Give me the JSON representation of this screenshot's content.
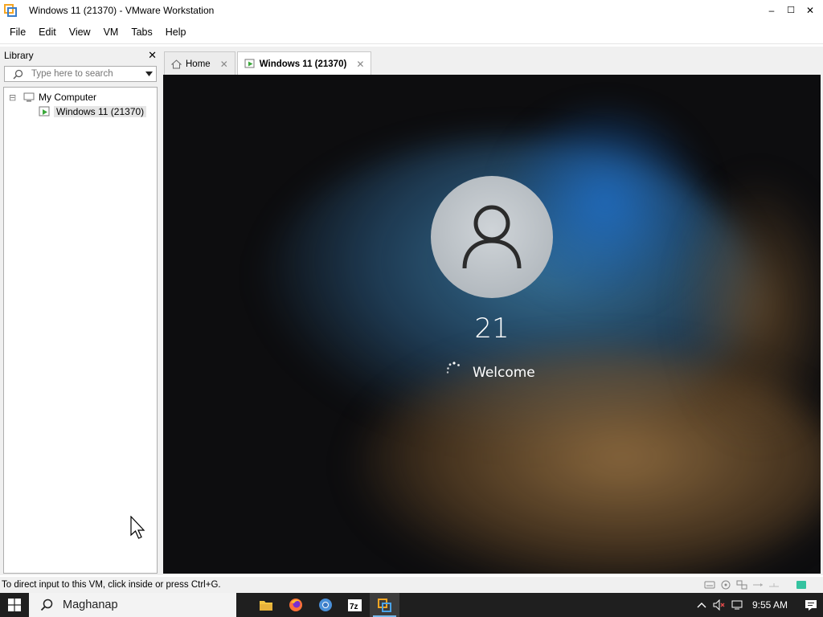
{
  "window": {
    "title": "Windows 11 (21370) - VMware Workstation",
    "minimize_glyph": "–",
    "maximize_glyph": "☐",
    "close_glyph": "✕"
  },
  "menu": [
    "File",
    "Edit",
    "View",
    "VM",
    "Tabs",
    "Help"
  ],
  "library": {
    "title": "Library",
    "close_glyph": "✕",
    "search_placeholder": "Type here to search",
    "tree": {
      "root_label": "My Computer",
      "root_toggle": "⊟",
      "vm_label": "Windows 11 (21370)"
    }
  },
  "tabs": [
    {
      "label": "Home",
      "close": "✕"
    },
    {
      "label": "Windows 11 (21370)",
      "close": "✕"
    }
  ],
  "vm": {
    "user_name": "21",
    "status": "Welcome"
  },
  "statusbar": {
    "text": "To direct input to this VM, click inside or press Ctrl+G."
  },
  "taskbar": {
    "search_text": "Maghanap",
    "clock": "9:55 AM",
    "apps": [
      "file-explorer-icon",
      "firefox-icon",
      "chrome-icon",
      "7zip-icon",
      "vmware-icon"
    ]
  },
  "colors": {
    "accent": "#76b9ed",
    "taskbar": "#1f1f1f"
  }
}
